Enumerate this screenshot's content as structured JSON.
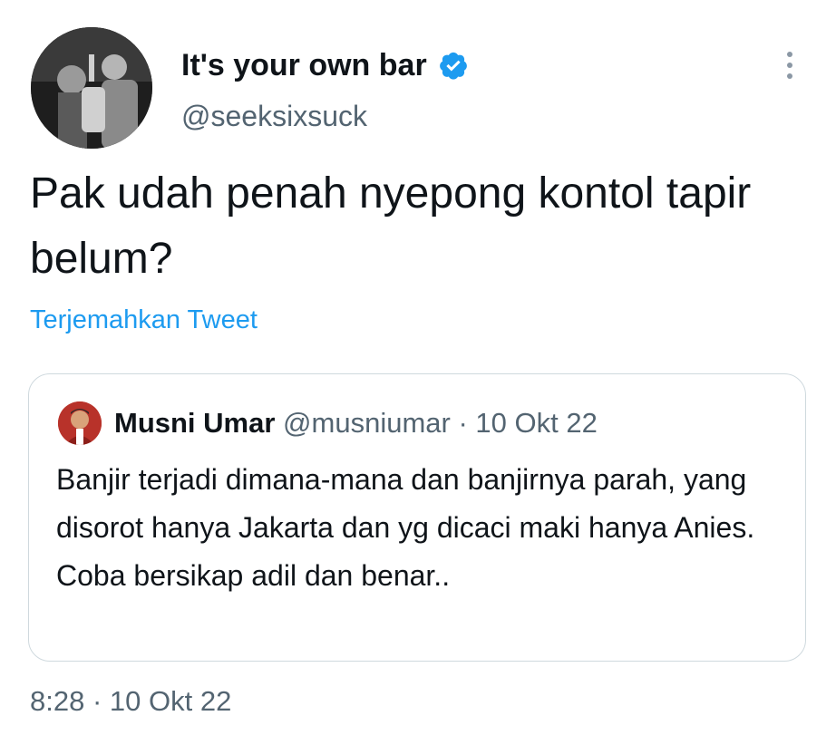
{
  "author": {
    "display_name": "It's your own bar",
    "handle": "@seeksixsuck",
    "verified": true,
    "avatar_icon": "profile-photo"
  },
  "tweet": {
    "text": "Pak udah penah nyepong kontol tapir belum?",
    "translate_label": "Terjemahkan Tweet",
    "time": "8:28",
    "separator": "·",
    "date": "10 Okt 22"
  },
  "quoted_tweet": {
    "display_name": "Musni Umar",
    "handle": "@musniumar",
    "separator": "·",
    "date": "10 Okt 22",
    "text": "Banjir terjadi dimana-mana dan banjirnya parah, yang disorot hanya Jakarta dan yg dicaci maki hanya Anies. Coba bersikap adil dan benar.."
  },
  "colors": {
    "accent": "#1d9bf0",
    "secondary_text": "#536471",
    "border": "#cfd9de"
  }
}
